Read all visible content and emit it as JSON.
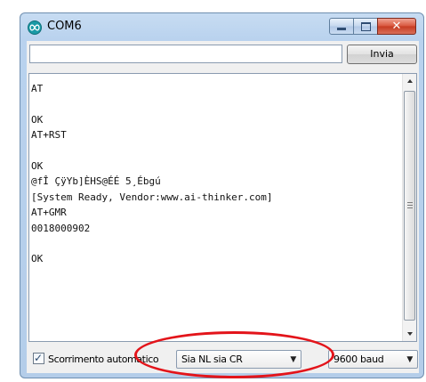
{
  "window": {
    "title": "COM6",
    "close_glyph": "✕"
  },
  "send": {
    "input_value": "",
    "button_label": "Invia"
  },
  "serial_output": {
    "lines": [
      "AT",
      "",
      "OK",
      "AT+RST",
      "",
      "OK",
      "@fÎ ÇÿYb]ÈHS@ÉÉ 5¸Ébgú",
      "[System Ready, Vendor:www.ai-thinker.com]",
      "AT+GMR",
      "0018000902",
      "",
      "OK"
    ]
  },
  "footer": {
    "autoscroll_label": "Scorrimento automatico",
    "autoscroll_checked": true,
    "check_glyph": "✓",
    "line_ending": {
      "selected": "Sia NL sia CR"
    },
    "baud_rate": {
      "selected": "9600 baud"
    },
    "dropdown_glyph": "▼"
  },
  "scroll": {
    "up_glyph": "▲",
    "down_glyph": "▼"
  },
  "colors": {
    "titlebar": "#b9d2ee",
    "close_button": "#d8553c",
    "highlight_oval": "#e3141a",
    "app_icon": "#1a9aa6"
  },
  "icons": {
    "app": "arduino-infinity-icon",
    "minimize": "minimize-icon",
    "maximize": "maximize-icon",
    "close": "close-icon"
  }
}
